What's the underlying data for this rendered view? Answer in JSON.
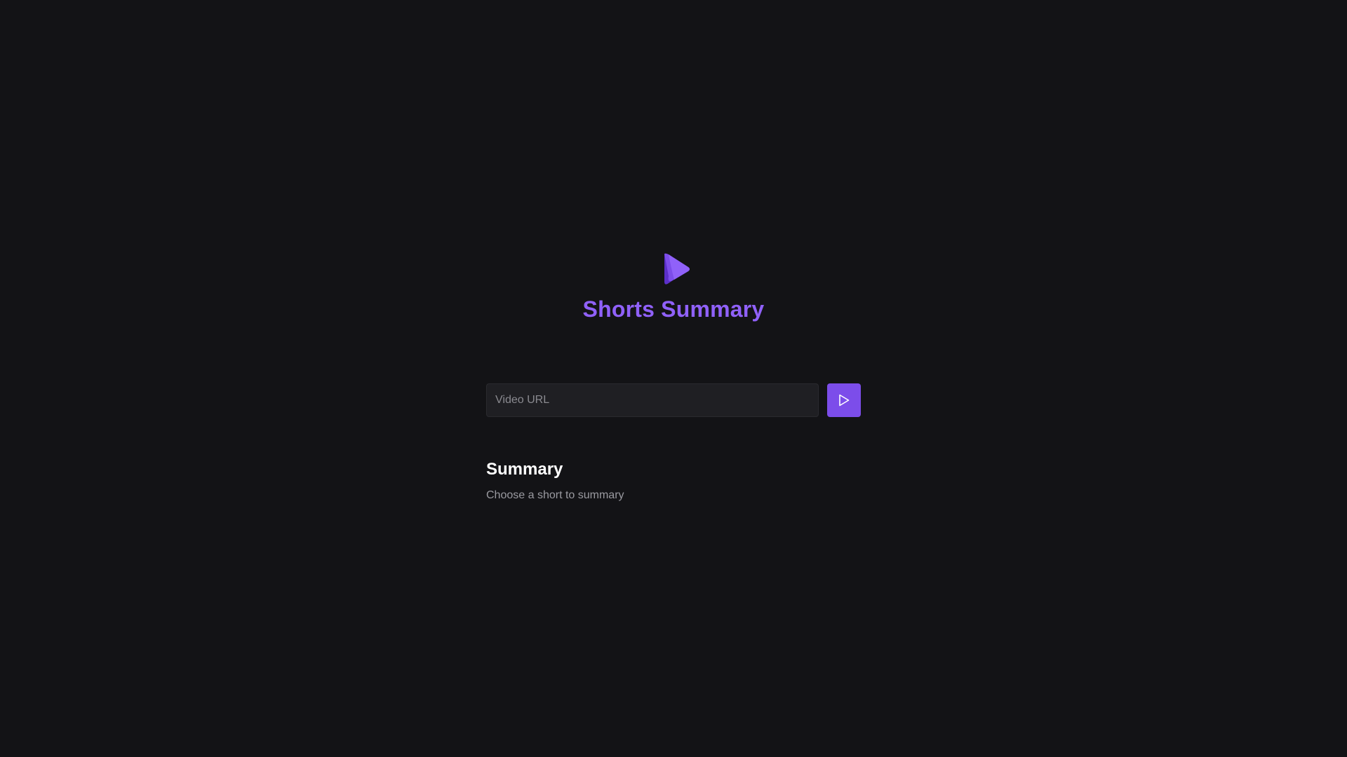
{
  "app": {
    "title": "Shorts Summary",
    "logo_icon": "play-logo-icon",
    "accent_color": "#9061f9",
    "button_color": "#7c4dea"
  },
  "search": {
    "placeholder": "Video URL",
    "value": "",
    "submit_icon": "play-icon"
  },
  "summary": {
    "heading": "Summary",
    "text": "Choose a short to summary"
  }
}
